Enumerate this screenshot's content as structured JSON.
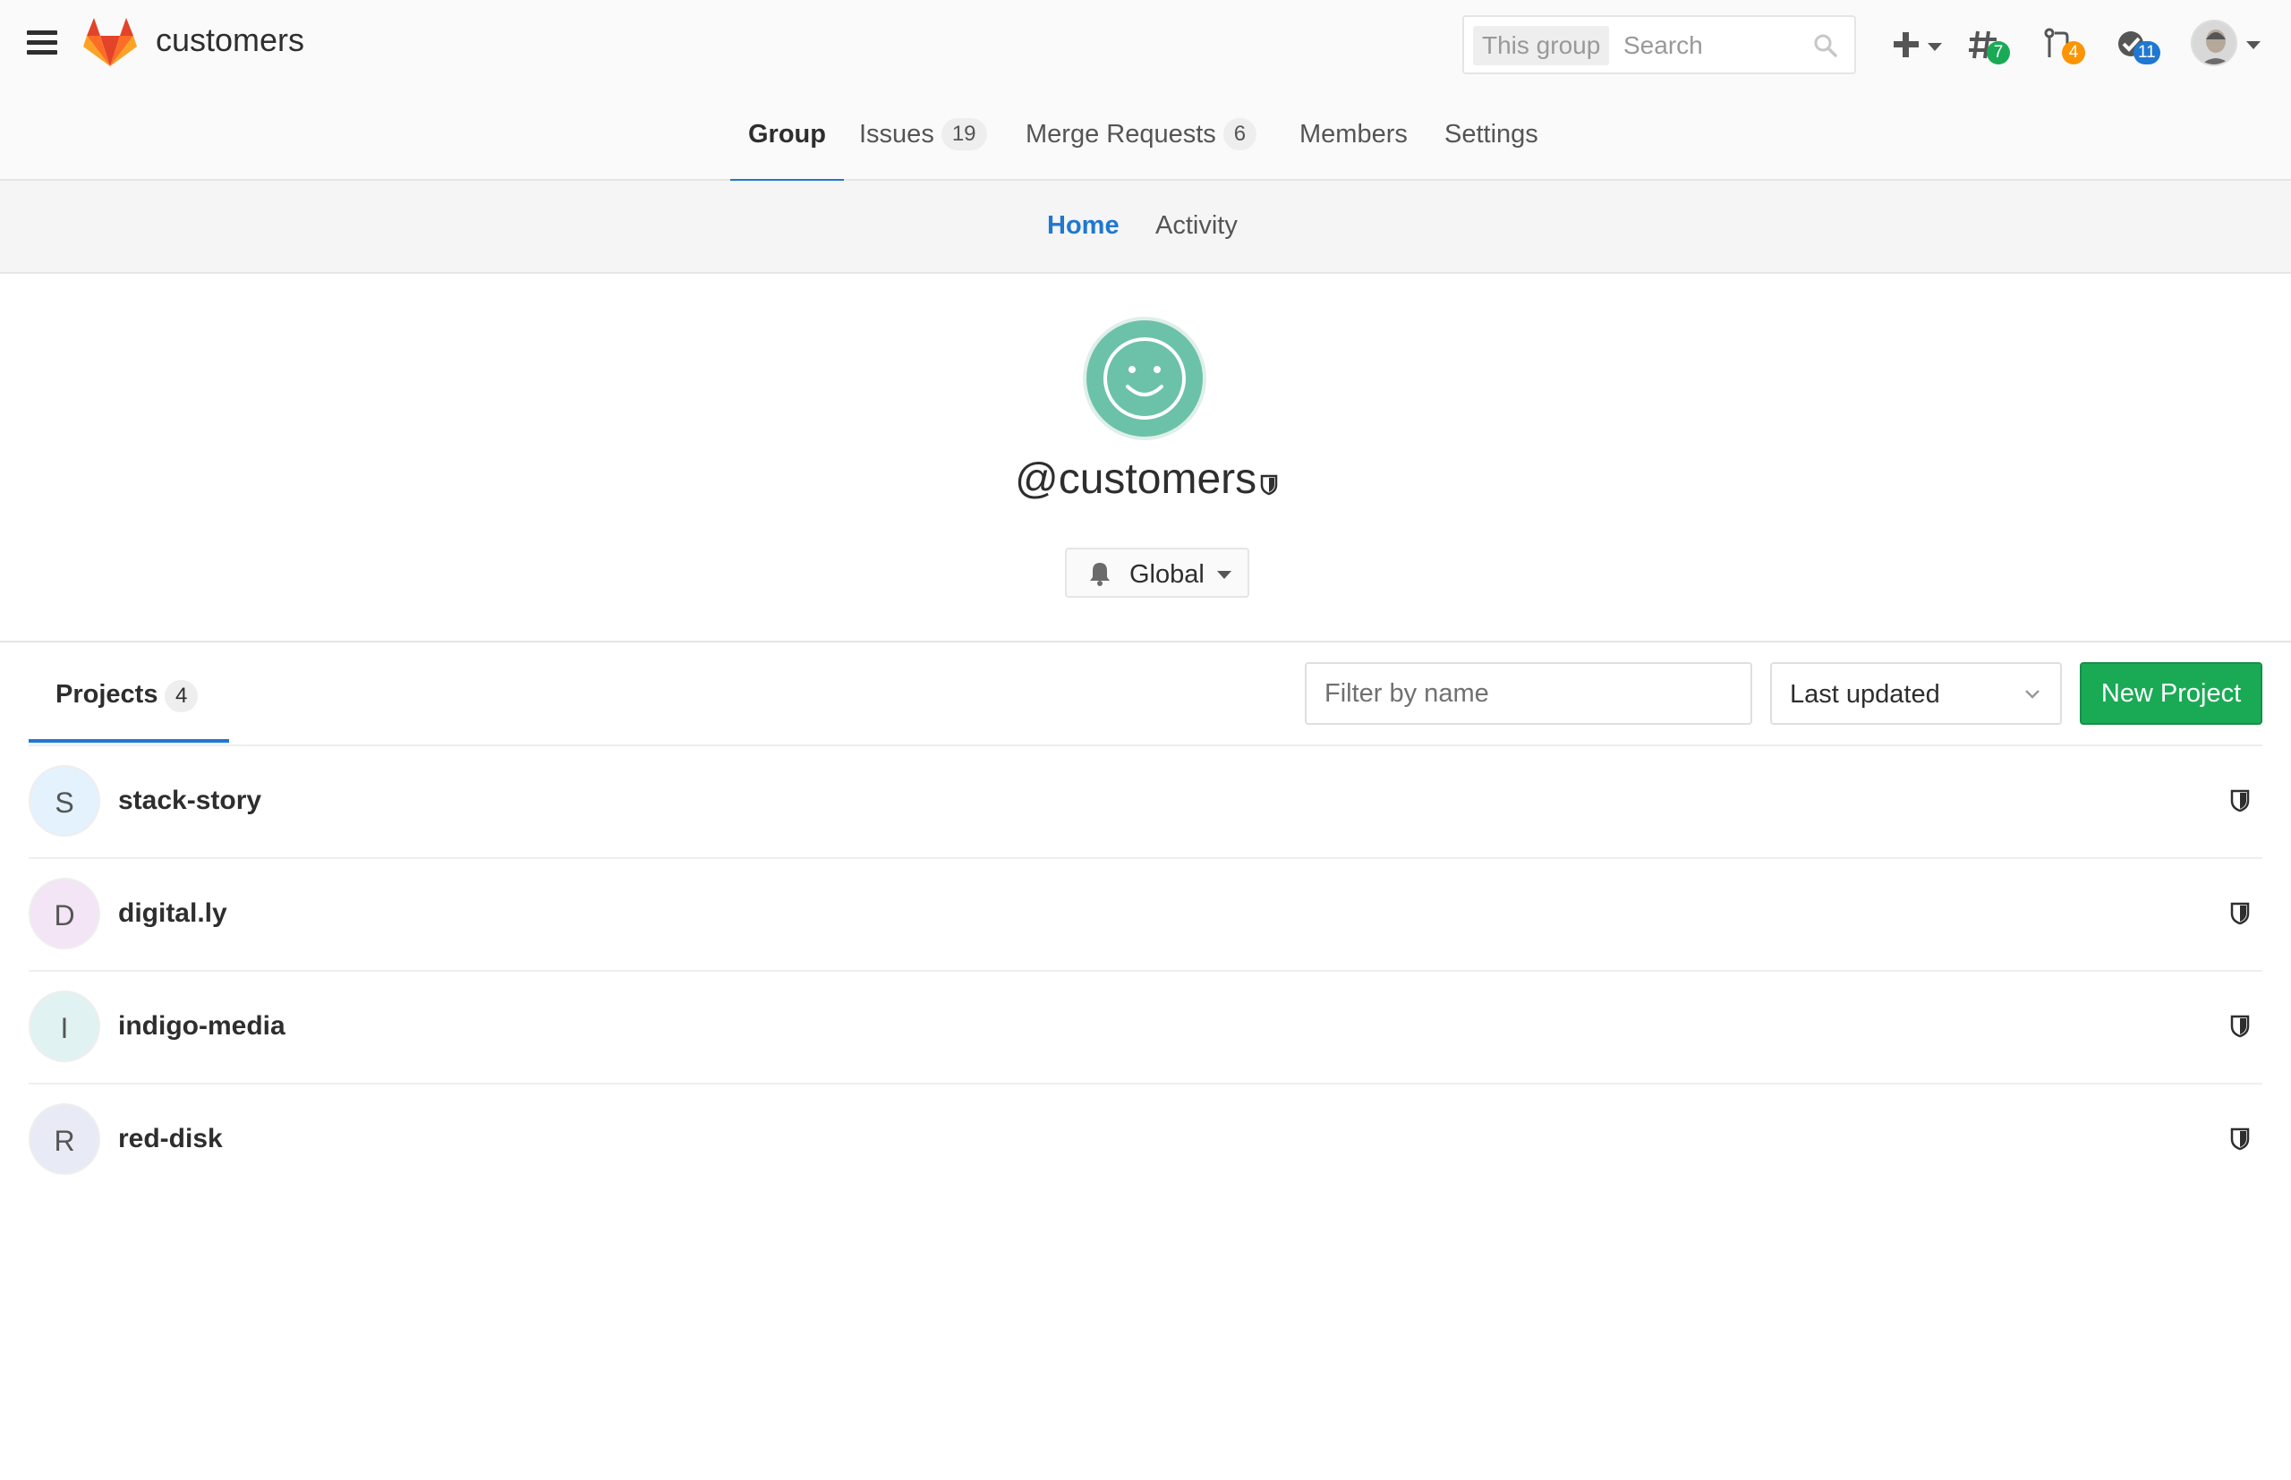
{
  "header": {
    "title": "customers",
    "search": {
      "scope": "This group",
      "placeholder": "Search"
    },
    "badges": {
      "issues": "7",
      "merge_requests": "4",
      "todos": "11"
    },
    "colors": {
      "issues_badge": "#1aaa55",
      "mr_badge": "#fc9403",
      "todos_badge": "#1f78d1"
    }
  },
  "tabs": [
    {
      "label": "Group",
      "count": ""
    },
    {
      "label": "Issues",
      "count": "19"
    },
    {
      "label": "Merge Requests",
      "count": "6"
    },
    {
      "label": "Members",
      "count": ""
    },
    {
      "label": "Settings",
      "count": ""
    }
  ],
  "subnav": {
    "home": "Home",
    "activity": "Activity"
  },
  "group": {
    "name": "@customers",
    "notification": "Global"
  },
  "projects": {
    "tab_label": "Projects",
    "count": "4",
    "filter_placeholder": "Filter by name",
    "sort": "Last updated",
    "new_button": "New Project",
    "items": [
      {
        "initial": "S",
        "name": "stack-story",
        "avatar_color": "#e3f2fd"
      },
      {
        "initial": "D",
        "name": "digital.ly",
        "avatar_color": "#f3e5f5"
      },
      {
        "initial": "I",
        "name": "indigo-media",
        "avatar_color": "#e0f2f1"
      },
      {
        "initial": "R",
        "name": "red-disk",
        "avatar_color": "#e8eaf6"
      }
    ]
  }
}
